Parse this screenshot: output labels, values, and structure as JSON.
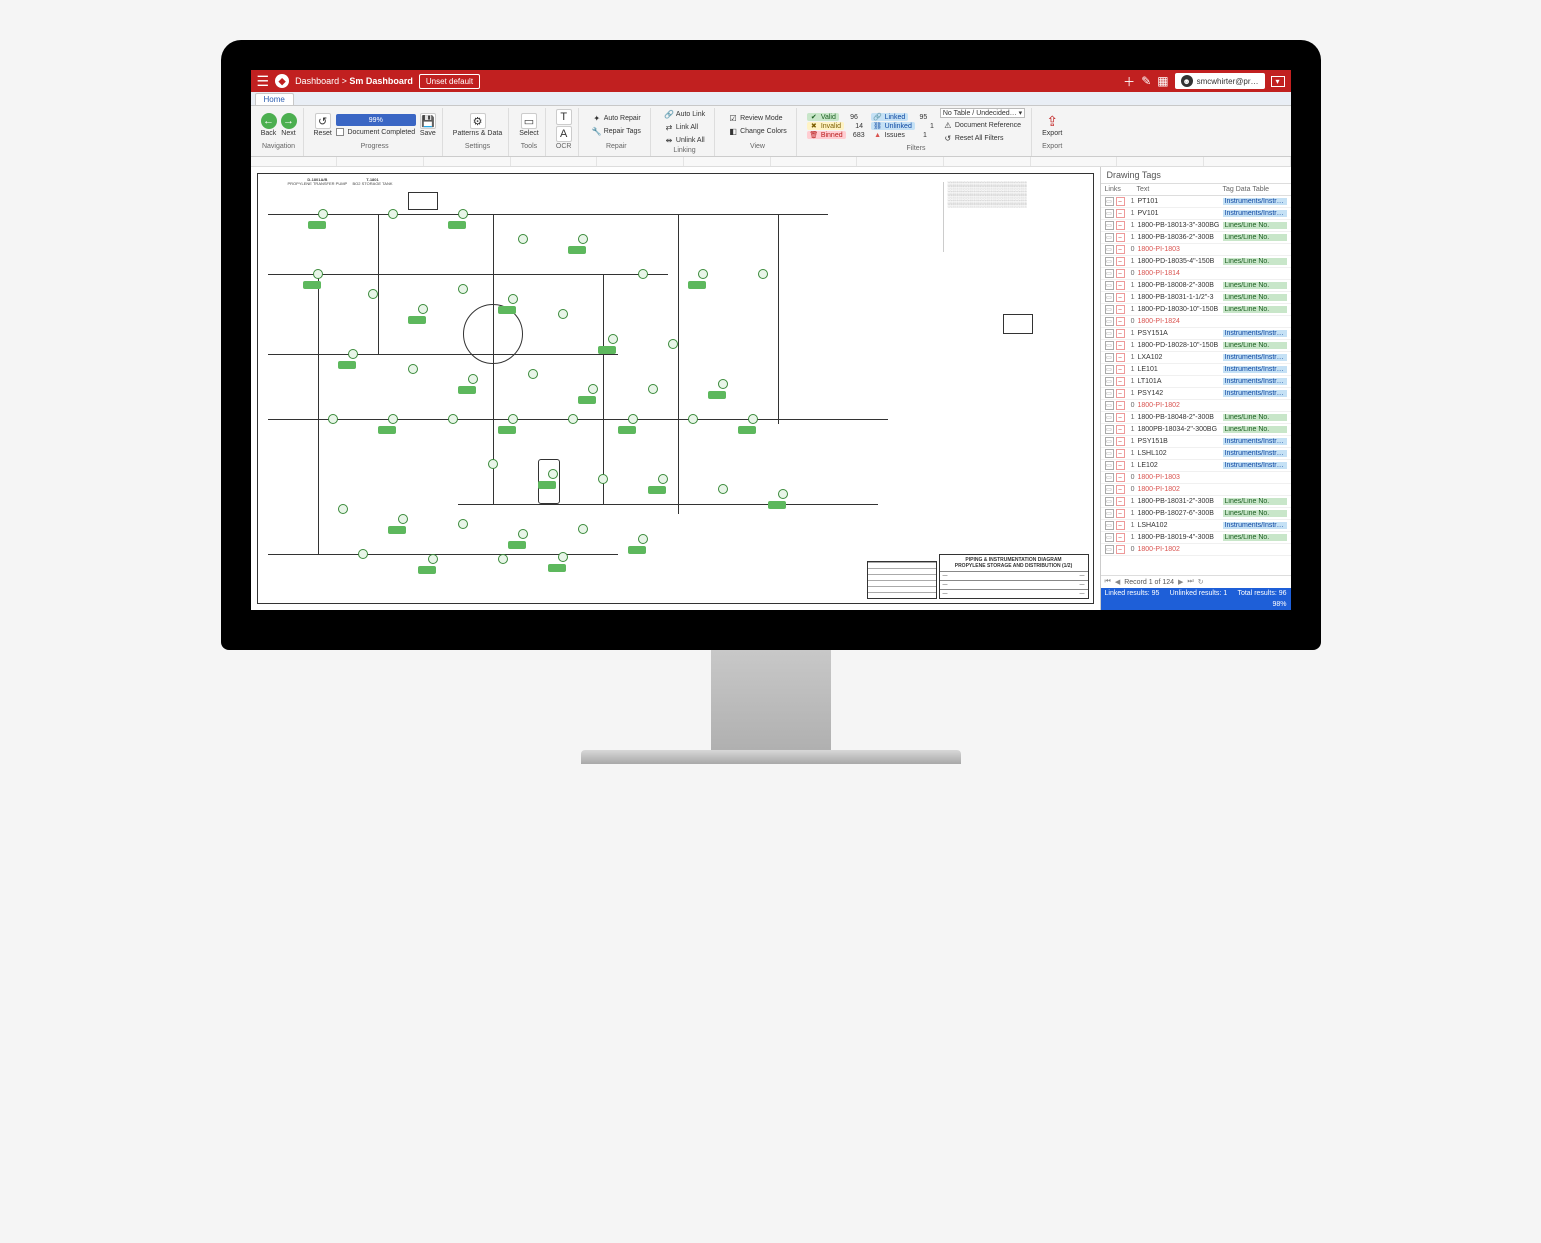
{
  "breadcrumb": {
    "root": "Dashboard",
    "sep": ">",
    "current": "Sm Dashboard"
  },
  "topbar": {
    "unset": "Unset default",
    "user": "smcwhirter@pr…"
  },
  "tab": {
    "home": "Home"
  },
  "ribbon": {
    "navigation": {
      "label": "Navigation",
      "back": "Back",
      "next": "Next"
    },
    "progress": {
      "label": "Progress",
      "reset": "Reset",
      "percent": "99%",
      "doc_completed": "Document Completed",
      "save": "Save"
    },
    "settings": {
      "label": "Settings",
      "patterns": "Patterns & Data"
    },
    "tools": {
      "label": "Tools",
      "select": "Select"
    },
    "ocr": {
      "label": "OCR"
    },
    "repair": {
      "label": "Repair",
      "auto_repair": "Auto Repair",
      "repair_tags": "Repair Tags"
    },
    "linking": {
      "label": "Linking",
      "auto_link": "Auto Link",
      "link_all": "Link All",
      "unlink_all": "Unlink All"
    },
    "view": {
      "label": "View",
      "review_mode": "Review Mode",
      "change_colors": "Change Colors"
    },
    "filters": {
      "label": "Filters",
      "valid": "Valid",
      "valid_n": "96",
      "invalid": "Invalid",
      "invalid_n": "14",
      "binned": "Binned",
      "binned_n": "683",
      "linked": "Linked",
      "linked_n": "95",
      "unlinked": "Unlinked",
      "unlinked_n": "1",
      "issues": "Issues",
      "issues_n": "1",
      "notable": "No Table / Undecided…",
      "docref": "Document Reference",
      "reset_all": "Reset All Filters"
    },
    "export": {
      "label": "Export",
      "btn": "Export"
    }
  },
  "canvas": {
    "title1": "PIPING & INSTRUMENTATION DIAGRAM",
    "title2": "PROPYLENE STORAGE AND DISTRIBUTION (1/2)",
    "header_left1": "D-1801A/B",
    "header_left2": "PROPYLENE TRANSFER PUMP",
    "header_mid1": "T-1801",
    "header_mid2": "BO2 STORAGE TANK"
  },
  "rpanel": {
    "title": "Drawing Tags",
    "col_links": "Links",
    "col_text": "Text",
    "col_table": "Tag Data Table",
    "pager": "Record 1 of 124",
    "summary_linked": "Linked results: 95",
    "summary_unlinked": "Unlinked results: 1",
    "summary_total": "Total results: 96",
    "summary_pct": "98%"
  },
  "tags": [
    {
      "links": "1",
      "text": "PT101",
      "table": "Instruments/Instru…",
      "cls": "inst"
    },
    {
      "links": "1",
      "text": "PV101",
      "table": "Instruments/Instru…",
      "cls": "inst"
    },
    {
      "links": "1",
      "text": "1800-PB-18013-3\"-300BG",
      "table": "Lines/Line No.",
      "cls": "line"
    },
    {
      "links": "1",
      "text": "1800-PB-18036-2\"-300B",
      "table": "Lines/Line No.",
      "cls": "line"
    },
    {
      "links": "0",
      "text": "1800-PI-1803",
      "table": "",
      "cls": "unlinked"
    },
    {
      "links": "1",
      "text": "1800-PD-18035-4\"-150B",
      "table": "Lines/Line No.",
      "cls": "line"
    },
    {
      "links": "0",
      "text": "1800-PI-1814",
      "table": "",
      "cls": "unlinked"
    },
    {
      "links": "1",
      "text": "1800-PB-18008-2\"-300B",
      "table": "Lines/Line No.",
      "cls": "line"
    },
    {
      "links": "1",
      "text": "1800-PB-18031-1-1/2\"-3",
      "table": "Lines/Line No.",
      "cls": "line"
    },
    {
      "links": "1",
      "text": "1800-PD-18030-10\"-150B",
      "table": "Lines/Line No.",
      "cls": "line"
    },
    {
      "links": "0",
      "text": "1800-PI-1824",
      "table": "",
      "cls": "unlinked"
    },
    {
      "links": "1",
      "text": "PSY151A",
      "table": "Instruments/Instru…",
      "cls": "inst"
    },
    {
      "links": "1",
      "text": "1800-PD-18028-10\"-150B",
      "table": "Lines/Line No.",
      "cls": "line"
    },
    {
      "links": "1",
      "text": "LXA102",
      "table": "Instruments/Instru…",
      "cls": "inst"
    },
    {
      "links": "1",
      "text": "LE101",
      "table": "Instruments/Instru…",
      "cls": "inst"
    },
    {
      "links": "1",
      "text": "LT101A",
      "table": "Instruments/Instru…",
      "cls": "inst"
    },
    {
      "links": "1",
      "text": "PSY142",
      "table": "Instruments/Instru…",
      "cls": "inst"
    },
    {
      "links": "0",
      "text": "1800-PI-1802",
      "table": "",
      "cls": "unlinked"
    },
    {
      "links": "1",
      "text": "1800-PB-18048-2\"-300B",
      "table": "Lines/Line No.",
      "cls": "line"
    },
    {
      "links": "1",
      "text": "1800PB-18034-2\"-300BG",
      "table": "Lines/Line No.",
      "cls": "line"
    },
    {
      "links": "1",
      "text": "PSY151B",
      "table": "Instruments/Instru…",
      "cls": "inst"
    },
    {
      "links": "1",
      "text": "LSHL102",
      "table": "Instruments/Instru…",
      "cls": "inst"
    },
    {
      "links": "1",
      "text": "LE102",
      "table": "Instruments/Instru…",
      "cls": "inst"
    },
    {
      "links": "0",
      "text": "1800-PI-1803",
      "table": "",
      "cls": "unlinked"
    },
    {
      "links": "0",
      "text": "1800-PI-1802",
      "table": "",
      "cls": "unlinked"
    },
    {
      "links": "1",
      "text": "1800-PB-18031-2\"-300B",
      "table": "Lines/Line No.",
      "cls": "line"
    },
    {
      "links": "1",
      "text": "1800-PB-18027-6\"-300B",
      "table": "Lines/Line No.",
      "cls": "line"
    },
    {
      "links": "1",
      "text": "LSHA102",
      "table": "Instruments/Instru…",
      "cls": "inst"
    },
    {
      "links": "1",
      "text": "1800-PB-18019-4\"-300B",
      "table": "Lines/Line No.",
      "cls": "line"
    },
    {
      "links": "0",
      "text": "1800-PI-1802",
      "table": "",
      "cls": "unlinked"
    }
  ]
}
